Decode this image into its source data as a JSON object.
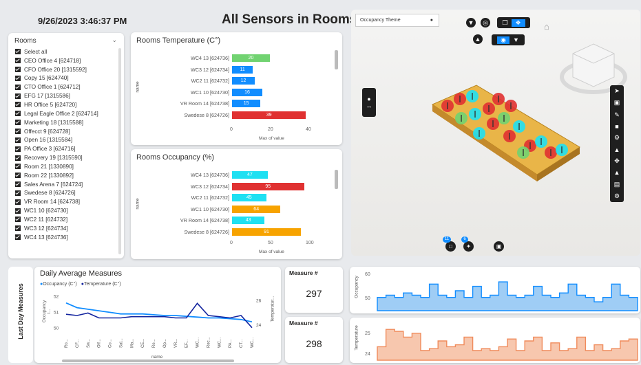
{
  "header": {
    "timestamp": "9/26/2023 3:46:37 PM",
    "title": "All Sensors in Rooms"
  },
  "slicer": {
    "title": "Rooms",
    "items": [
      "Select all",
      "CEO Office 4 [624718]",
      "CFO Office 20 [1315592]",
      "Copy 15 [624740]",
      "CTO Office 1 [624712]",
      "EFG 17 [1315586]",
      "HR Office 5 [624720]",
      "Legal Eagle Office 2 [624714]",
      "Marketing 18 [1315588]",
      "Offecct 9 [624728]",
      "Open 16 [1315584]",
      "PA Office 3 [624716]",
      "Recovery 19 [1315590]",
      "Room 21 [1330890]",
      "Room 22 [1330892]",
      "Sales Arena 7 [624724]",
      "Swedese 8 [624726]",
      "VR Room 14 [624738]",
      "WC1 10 [624730]",
      "WC2 11 [624732]",
      "WC3 12 [624734]",
      "WC4 13 [624736]"
    ]
  },
  "temp_chart": {
    "title": "Rooms Temperature (C°)",
    "ylabel": "name",
    "xlabel": "Max of value",
    "ticks": [
      "0",
      "20",
      "40"
    ]
  },
  "occ_chart": {
    "title": "Rooms Occupancy (%)",
    "ylabel": "name",
    "xlabel": "Max of value",
    "ticks": [
      "0",
      "50",
      "100"
    ]
  },
  "daily": {
    "title": "Daily Average Measures",
    "legend": [
      "Occupancy (C°)",
      "Temperature (C°)"
    ],
    "left_axis": "Occupancy I...",
    "right_axis": "Temperatur...",
    "xlabel": "name",
    "left_ticks": [
      "52",
      "51",
      "50"
    ],
    "right_ticks": [
      "26",
      "24"
    ],
    "x_ticks": [
      "Ro...",
      "CF...",
      "Sw...",
      "Off...",
      "Co...",
      "Sal...",
      "Ma...",
      "CE...",
      "Re...",
      "Op...",
      "VR...",
      "EF...",
      "WC...",
      "Rec...",
      "WC...",
      "PA...",
      "CT...",
      "WC..."
    ]
  },
  "side_label": "Last Day Measures",
  "measures": [
    {
      "label": "Measure #",
      "value": "297"
    },
    {
      "label": "Measure #",
      "value": "298"
    }
  ],
  "viewer": {
    "theme": "Occupancy Theme",
    "badge1": "11",
    "badge2": "6"
  },
  "occ_strip": {
    "ylabel": "Occupancy",
    "ticks": [
      "60",
      "50"
    ]
  },
  "tmp_strip": {
    "ylabel": "Temperature",
    "ticks": [
      "25",
      "24"
    ]
  },
  "colors": {
    "green": "#71d371",
    "blue": "#118dff",
    "red": "#e03131",
    "cyan": "#1fe0f2",
    "orange": "#f7a300",
    "dark": "#12239e",
    "strip_blue": "#9fcdf5",
    "strip_orange": "#f7c7ae"
  },
  "chart_data": [
    {
      "type": "bar",
      "title": "Rooms Temperature (C°)",
      "xlabel": "Max of value",
      "ylabel": "name",
      "xlim": [
        0,
        40
      ],
      "categories": [
        "WC4 13 [624736]",
        "WC3 12 [624734]",
        "WC2 11 [624732]",
        "WC1 10 [624730]",
        "VR Room 14 [624738]",
        "Swedese 8 [624726]"
      ],
      "values": [
        20,
        11,
        12,
        16,
        15,
        39
      ],
      "labels": [
        "20",
        "11",
        "12",
        "16",
        "15",
        "39"
      ],
      "bar_colors": [
        "#71d371",
        "#118dff",
        "#118dff",
        "#118dff",
        "#118dff",
        "#e03131"
      ]
    },
    {
      "type": "bar",
      "title": "Rooms Occupancy (%)",
      "xlabel": "Max of value",
      "ylabel": "name",
      "xlim": [
        0,
        100
      ],
      "categories": [
        "WC4 13 [624736]",
        "WC3 12 [624734]",
        "WC2 11 [624732]",
        "WC1 10 [624730]",
        "VR Room 14 [624738]",
        "Swedese 8 [624726]"
      ],
      "values": [
        47,
        95,
        45,
        64,
        43,
        91
      ],
      "labels": [
        "47",
        "95",
        "45",
        "64",
        "43",
        "91"
      ],
      "bar_colors": [
        "#1fe0f2",
        "#e03131",
        "#1fe0f2",
        "#f7a300",
        "#1fe0f2",
        "#f7a300"
      ]
    },
    {
      "type": "line",
      "title": "Daily Average Measures",
      "xlabel": "name",
      "categories": [
        "Ro...",
        "CF...",
        "Sw...",
        "Off...",
        "Co...",
        "Sal...",
        "Ma...",
        "CE...",
        "Re...",
        "Op...",
        "VR...",
        "EF...",
        "WC...",
        "Rec...",
        "WC...",
        "PA...",
        "CT...",
        "WC..."
      ],
      "series": [
        {
          "name": "Occupancy (C°)",
          "axis": "left",
          "values": [
            51.6,
            51.3,
            51.2,
            51.1,
            51.0,
            50.9,
            50.9,
            50.9,
            50.85,
            50.8,
            50.8,
            50.75,
            50.7,
            50.65,
            50.65,
            50.6,
            50.55,
            50.4
          ]
        },
        {
          "name": "Temperature (C°)",
          "axis": "right",
          "values": [
            24.9,
            24.8,
            25.0,
            24.6,
            24.6,
            24.6,
            24.7,
            24.7,
            24.7,
            24.7,
            24.6,
            24.6,
            25.8,
            24.8,
            24.7,
            24.6,
            24.8,
            23.8
          ]
        }
      ],
      "ylim_left": [
        49.8,
        52.5
      ],
      "ylim_right": [
        23.5,
        27
      ]
    },
    {
      "type": "area",
      "ylabel": "Occupancy",
      "ylim": [
        44,
        62
      ],
      "values": [
        50,
        51,
        50,
        52,
        51,
        50,
        56,
        51,
        50,
        53,
        50,
        55,
        50,
        51,
        57,
        51,
        50,
        51,
        55,
        51,
        50,
        52,
        56,
        51,
        50,
        48,
        50,
        56,
        51,
        50
      ]
    },
    {
      "type": "area",
      "ylabel": "Temperature",
      "ylim": [
        23.6,
        25.6
      ],
      "values": [
        24.3,
        25.2,
        25.1,
        24.8,
        25.0,
        24.1,
        24.2,
        24.6,
        24.3,
        24.4,
        24.8,
        24.1,
        24.2,
        24.1,
        24.3,
        24.7,
        24.1,
        24.6,
        24.8,
        24.1,
        24.5,
        24.1,
        24.2,
        24.8,
        24.1,
        24.4,
        24.1,
        24.2,
        24.6,
        24.7
      ]
    }
  ]
}
